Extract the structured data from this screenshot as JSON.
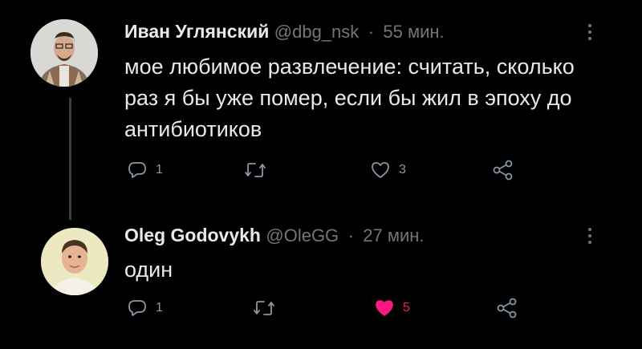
{
  "tweets": [
    {
      "author": "Иван Углянский",
      "handle": "@dbg_nsk",
      "separator": "·",
      "time": "55 мин.",
      "text": "мое любимое развлечение: считать, сколько раз я бы уже помер, если бы жил в эпоху до антибиотиков",
      "replies": "1",
      "retweets": "",
      "likes": "3",
      "liked": false
    },
    {
      "author": "Oleg Godovykh",
      "handle": "@OleGG",
      "separator": "·",
      "time": "27 мин.",
      "text": "один",
      "replies": "1",
      "retweets": "",
      "likes": "5",
      "liked": true
    }
  ],
  "colors": {
    "background": "#000000",
    "text": "#e7e9ea",
    "secondary": "#71767b",
    "like_active": "#f91880"
  },
  "icons": [
    "reply-icon",
    "retweet-icon",
    "like-icon",
    "share-icon",
    "more-icon"
  ]
}
